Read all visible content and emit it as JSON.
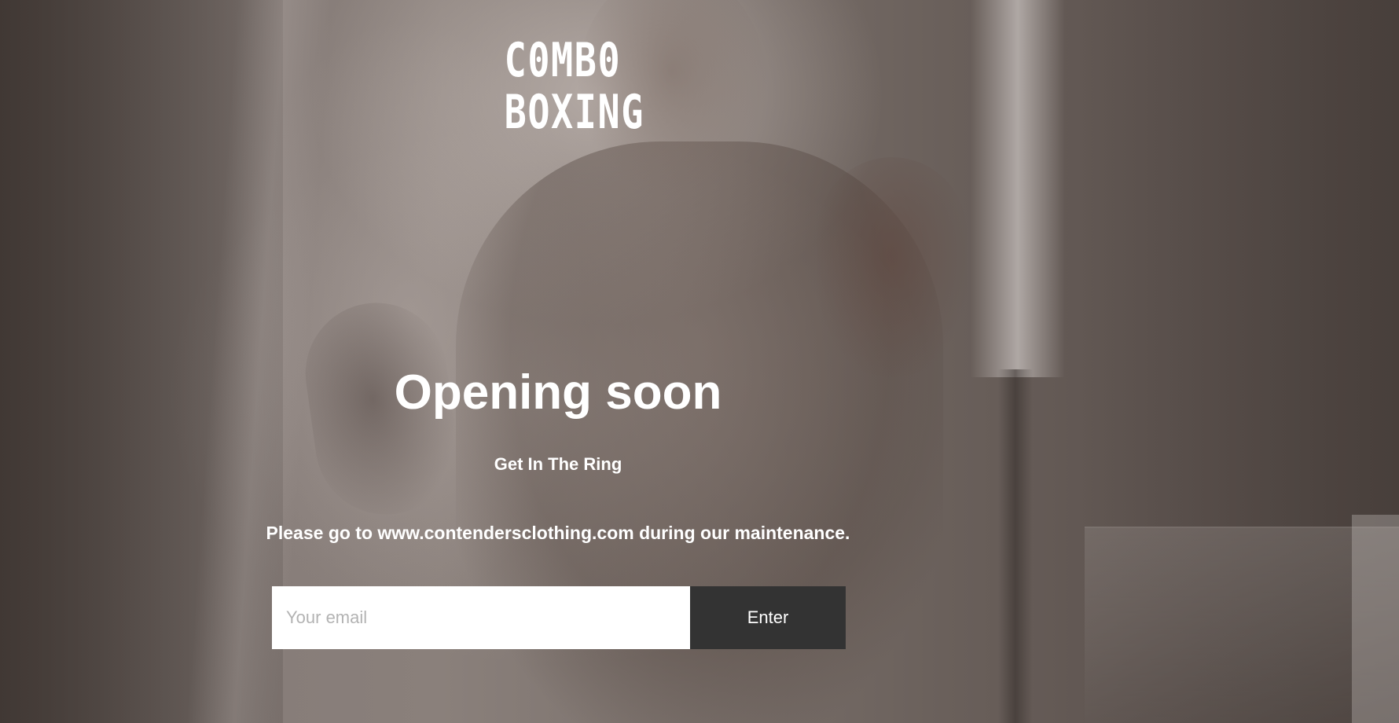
{
  "brand": {
    "logo_line1": "C0MB0",
    "logo_line2": "BOXING"
  },
  "hero": {
    "headline": "Opening soon",
    "subtitle": "Get In The Ring",
    "notice": "Please go to www.contendersclothing.com during our maintenance."
  },
  "signup": {
    "email_placeholder": "Your email",
    "email_value": "",
    "button_label": "Enter"
  },
  "colors": {
    "text": "#ffffff",
    "button_bg": "#333333",
    "input_bg": "#ffffff",
    "placeholder": "#b3b3b3"
  }
}
